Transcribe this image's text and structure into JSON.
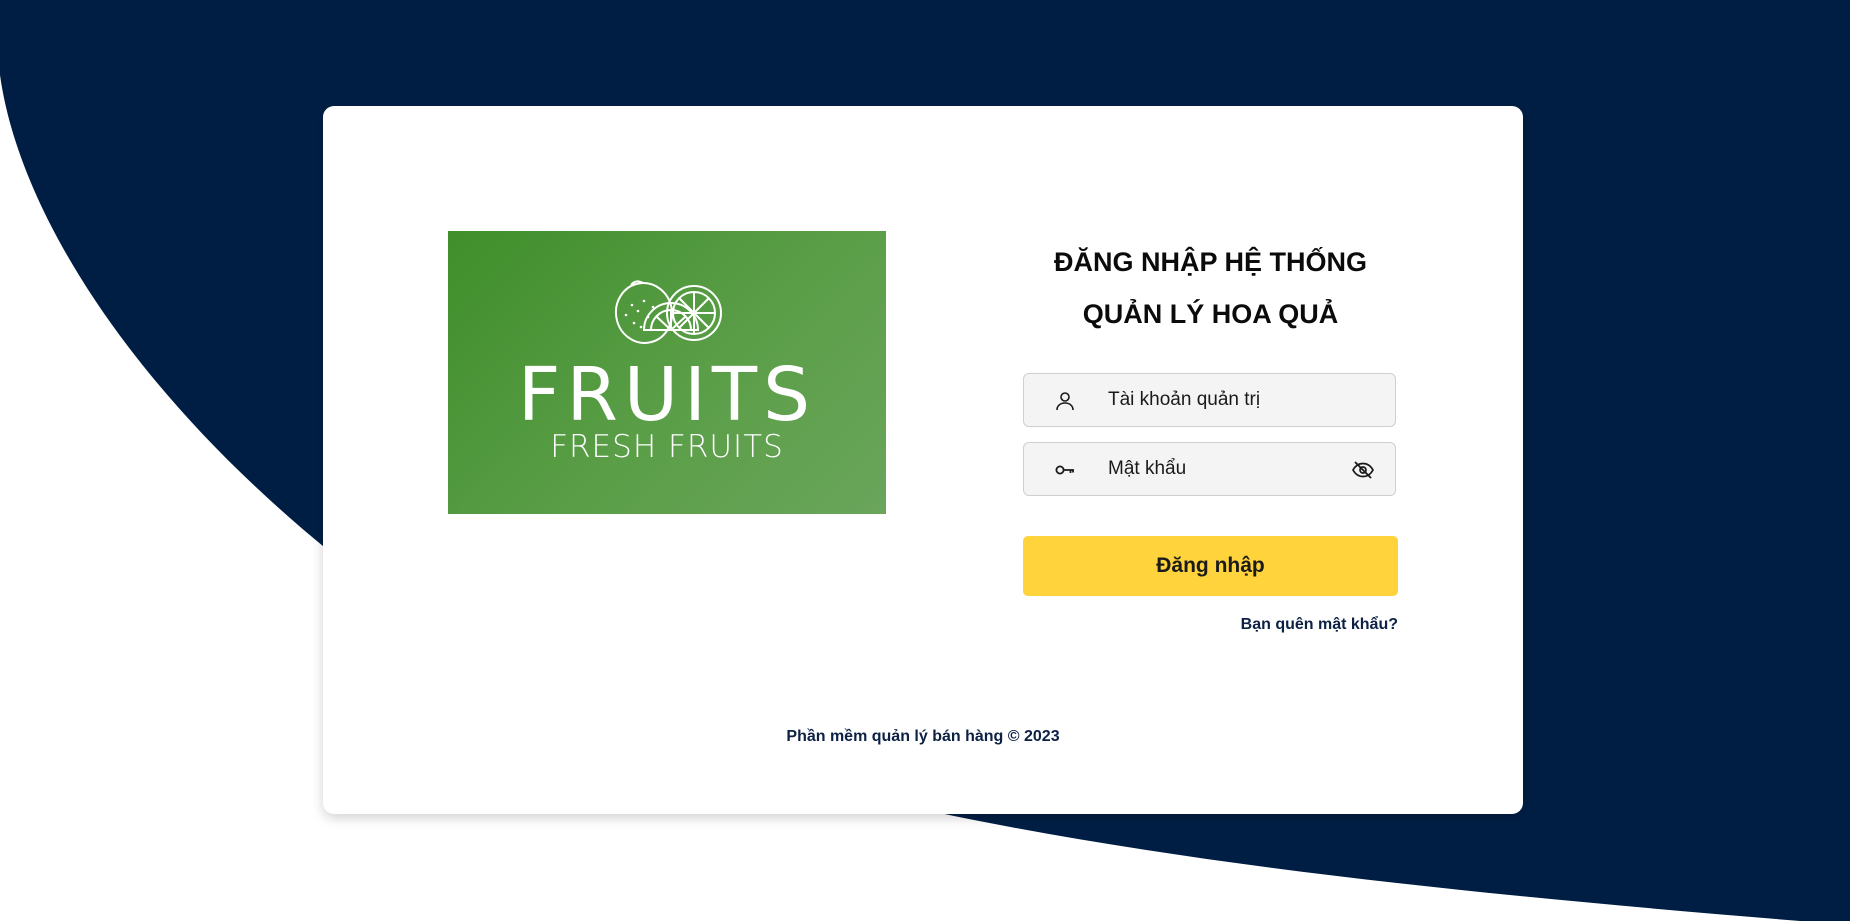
{
  "colors": {
    "background_navy": "#001e44",
    "accent_yellow": "#fed33b",
    "logo_green": "#4d9a3b"
  },
  "logo": {
    "word": "FRUITS",
    "subtitle": "FRESH FRUITS",
    "icon": "fruit-illustration-icon"
  },
  "login": {
    "title_line1": "ĐĂNG NHẬP HỆ THỐNG",
    "title_line2": "QUẢN LÝ HOA QUẢ",
    "username_placeholder": "Tài khoản quản trị",
    "username_icon": "user-icon",
    "password_placeholder": "Mật khẩu",
    "password_icon": "key-icon",
    "toggle_icon": "eye-slash-icon",
    "submit_label": "Đăng nhập",
    "forgot_label": "Bạn quên mật khẩu?"
  },
  "footer": {
    "text": "Phần mềm quản lý bán hàng © 2023"
  }
}
